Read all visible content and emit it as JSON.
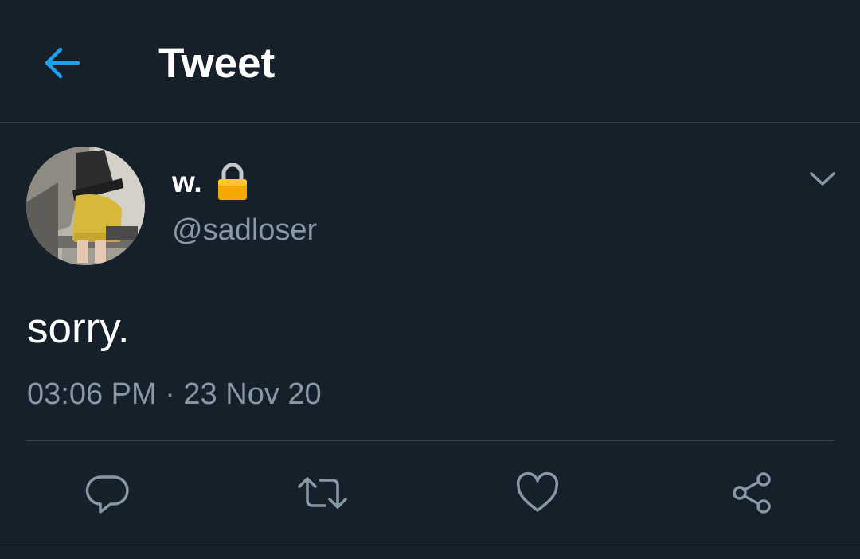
{
  "header": {
    "title": "Tweet",
    "back_icon": "arrow-left-icon"
  },
  "tweet": {
    "author": {
      "display_name": "w.",
      "locked_icon": "lock-icon",
      "handle": "@sadloser"
    },
    "text": "sorry.",
    "timestamp": "03:06 PM · 23 Nov 20"
  },
  "actions": [
    "reply-icon",
    "retweet-icon",
    "like-icon",
    "share-icon"
  ],
  "colors": {
    "background": "#15202b",
    "accent": "#1da1f2",
    "secondary_text": "#8899a6",
    "border": "#38444d"
  }
}
